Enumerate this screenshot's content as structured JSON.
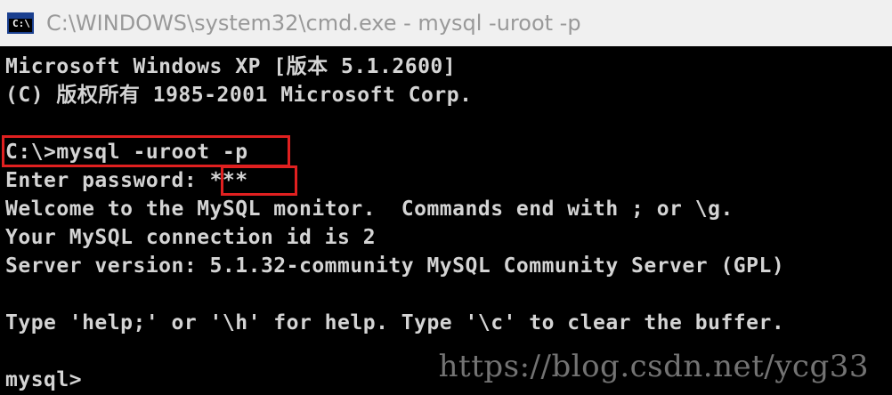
{
  "window": {
    "icon_label": "C:\\",
    "title": "C:\\WINDOWS\\system32\\cmd.exe - mysql -uroot -p"
  },
  "console": {
    "lines": [
      "Microsoft Windows XP [版本 5.1.2600]",
      "(C) 版权所有 1985-2001 Microsoft Corp.",
      "",
      "C:\\>mysql -uroot -p",
      "Enter password: ",
      "Welcome to the MySQL monitor.  Commands end with ; or \\g.",
      "Your MySQL connection id is 2",
      "Server version: 5.1.32-community MySQL Community Server (GPL)",
      "",
      "Type 'help;' or '\\h' for help. Type '\\c' to clear the buffer.",
      "",
      "mysql>"
    ],
    "password_mask": "***"
  },
  "colors": {
    "highlight": "#e02020",
    "console_bg": "#000000",
    "console_text": "#d4d4d4",
    "titlebar_bg": "#f0f0f0",
    "title_text": "#999999"
  },
  "watermark": "https://blog.csdn.net/ycg33"
}
